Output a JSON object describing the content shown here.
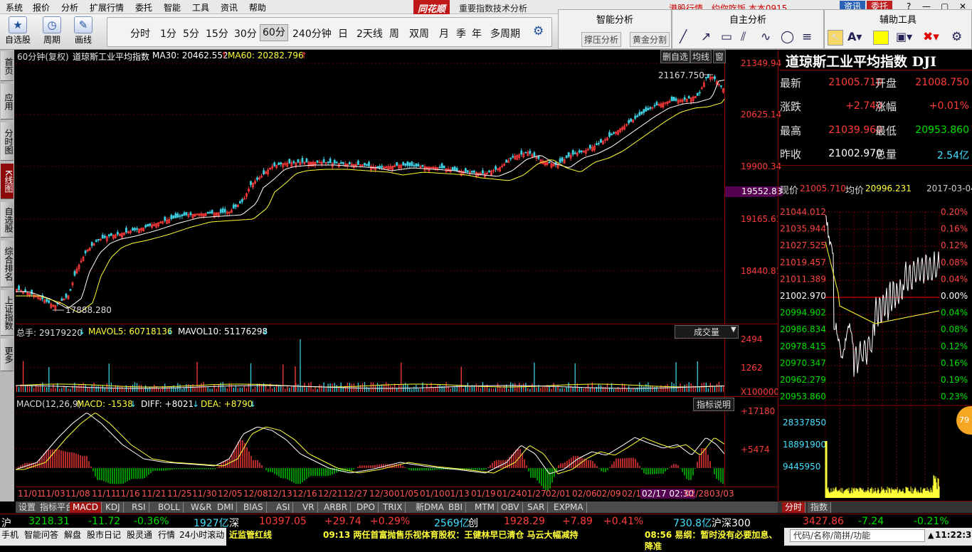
{
  "menu": [
    "系统",
    "报价",
    "分析",
    "扩展行情",
    "委托",
    "智能",
    "工具",
    "资讯",
    "帮助"
  ],
  "brand": "同花顺",
  "window_subtitle": "重要指数技术分析",
  "marquee": "港股行情，约你吃饭   本本0915",
  "window_buttons": {
    "info": "资讯",
    "trade": "委托"
  },
  "toolbar": {
    "buttons": [
      {
        "label": "自选股",
        "icon": "star-icon"
      },
      {
        "label": "周期",
        "icon": "clock-icon"
      },
      {
        "label": "画线",
        "icon": "pencil-icon"
      }
    ],
    "periods": [
      "分时",
      "1分",
      "5分",
      "15分",
      "30分",
      "60分",
      "240分钟",
      "日",
      "2天线",
      "周",
      "双周",
      "月",
      "季",
      "年",
      "多周期"
    ],
    "selected_period": "60分"
  },
  "smart_panel": {
    "title": "智能分析",
    "buttons": [
      "撑压分析",
      "黄金分割"
    ]
  },
  "draw_panel": {
    "title": "自主分析"
  },
  "assist_panel": {
    "title": "辅助工具"
  },
  "left_nav": [
    {
      "label": "首页"
    },
    {
      "label": "应用"
    },
    {
      "label": "分时图"
    },
    {
      "label": "K线图",
      "active": true
    },
    {
      "label": "自选股"
    },
    {
      "label": "综合排名"
    },
    {
      "label": "上证指数"
    },
    {
      "label": "更多"
    }
  ],
  "kline": {
    "period_label": "60分钟(复权)",
    "name": "道琼斯工业平均指数",
    "ma30_label": "MA30: 20462.552",
    "ma60_label": "MA60: 20282.796",
    "buttons": [
      "删自选",
      "均线",
      "窗"
    ],
    "high_mark": "21167.750",
    "low_mark": "17888.280",
    "price_ticks": [
      "21349.94",
      "20625.14",
      "19900.34",
      "19165.61",
      "18440.81"
    ],
    "crosshair_price": "19552.83"
  },
  "volume": {
    "total_label": "总手: 29179220",
    "mavol5_label": "MAVOL5: 60718136",
    "mavol10_label": "MAVOL10: 51176298",
    "selector": "成交量",
    "ticks": [
      "2494",
      "1262"
    ],
    "unit": "X100000"
  },
  "macd": {
    "title": "MACD(12,26,9)",
    "macd_label": "MACD: -1538",
    "diff_label": "DIFF: +8021",
    "dea_label": "DEA: +8790",
    "button": "指标说明",
    "ticks": [
      "+17180",
      "+5474"
    ]
  },
  "x_axis": [
    "11/01",
    "11/03",
    "11/08",
    "11/11",
    "11/16",
    "11/21",
    "11/25",
    "11/30",
    "12/05",
    "12/08",
    "12/13",
    "12/16",
    "12/21",
    "12/27",
    "12/30",
    "01/05",
    "01/10",
    "01/13",
    "01/19",
    "01/24",
    "01/27",
    "02/01",
    "02/06",
    "02/09",
    "02/14",
    "02/17 02:30",
    "02/28",
    "03/03"
  ],
  "info_panel": {
    "title": "道琼斯工业平均指数 DJI",
    "latest_label": "最新",
    "latest": "21005.710",
    "open_label": "开盘",
    "open": "21008.750",
    "change_label": "涨跌",
    "change": "+2.740",
    "pct_label": "涨幅",
    "pct": "+0.01%",
    "high_label": "最高",
    "high": "21039.960",
    "low_label": "最低",
    "low": "20953.860",
    "prev_label": "昨收",
    "prev": "21002.970",
    "amount_label": "总量",
    "amount": "2.54亿"
  },
  "intraday": {
    "price_label": "现价",
    "price": "21005.710",
    "avg_label": "均价",
    "avg": "20996.231",
    "date": "2017-03-04",
    "left_ticks": [
      "21044.012",
      "21035.944",
      "21027.525",
      "21019.457",
      "21011.389",
      "21002.970",
      "20994.902",
      "20986.834",
      "20978.415",
      "20970.347",
      "20962.279",
      "20953.860"
    ],
    "right_ticks": [
      "0.20%",
      "0.16%",
      "0.12%",
      "0.08%",
      "0.04%",
      "0.00%",
      "0.04%",
      "0.08%",
      "0.12%",
      "0.16%",
      "0.19%",
      "0.23%"
    ],
    "vol_ticks": [
      "28337850",
      "18891900",
      "9445950"
    ],
    "tabs": [
      "分时",
      "指数"
    ],
    "badge": "79"
  },
  "bottom_tabs": [
    "设置",
    "指标平台",
    "MACD",
    "KDJ",
    "RSI",
    "BOLL",
    "W&R",
    "DMI",
    "BIAS",
    "ASI",
    "VR",
    "ARBR",
    "DPO",
    "TRIX",
    "新DMA",
    "BBI",
    "MTM",
    "OBV",
    "SAR",
    "EXPMA"
  ],
  "bottom_tab_selected": "MACD",
  "ticker": {
    "sh_label": "沪",
    "sh_index": "3218.31",
    "sh_change": "-11.72",
    "sh_pct": "-0.36%",
    "sh_amount": "1927亿",
    "sz_label": "深",
    "sz_index": "10397.05",
    "sz_change": "+29.74",
    "sz_pct": "+0.29%",
    "sz_amount": "2569亿",
    "cy_label": "创",
    "cy_index": "1928.29",
    "cy_change": "+7.89",
    "cy_pct": "+0.41%",
    "cy_amount": "730.8亿",
    "hs_label": "沪深300",
    "hs_index": "3427.86",
    "hs_change": "-7.24",
    "hs_pct": "-0.21%"
  },
  "status": {
    "items": [
      "手机",
      "智能问答",
      "解盘",
      "股市日记",
      "股灵通",
      "行情",
      "24小时滚动"
    ],
    "news1": "近监管红线",
    "news2": "09:13 两任首富抛售乐视体育股权：王健林早已清仓 马云大幅减持",
    "news3": "08:56 易纲：暂时没有必要加息、降准",
    "search": "代码/名称/简拼/功能",
    "time": "11:22:31"
  }
}
